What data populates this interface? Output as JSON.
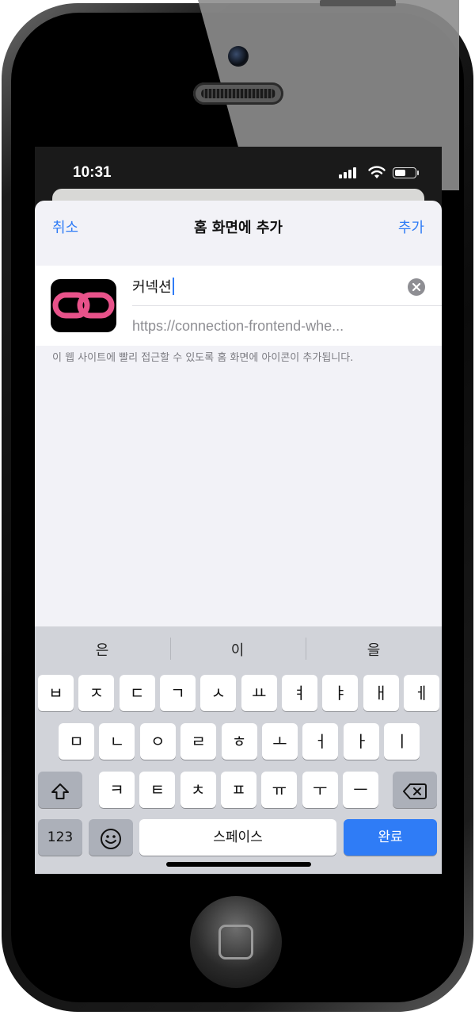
{
  "status": {
    "time": "10:31",
    "battery_level": 0.55
  },
  "sheet": {
    "cancel_label": "취소",
    "title": "홈 화면에 추가",
    "add_label": "추가",
    "name_value": "커넥션",
    "url": "https://connection-frontend-whe...",
    "description": "이 웹 사이트에 빨리 접근할 수 있도록 홈 화면에 아이콘이 추가됩니다."
  },
  "keyboard": {
    "suggestions": [
      "은",
      "이",
      "을"
    ],
    "row1": [
      "ㅂ",
      "ㅈ",
      "ㄷ",
      "ㄱ",
      "ㅅ",
      "ㅛ",
      "ㅕ",
      "ㅑ",
      "ㅐ",
      "ㅔ"
    ],
    "row2": [
      "ㅁ",
      "ㄴ",
      "ㅇ",
      "ㄹ",
      "ㅎ",
      "ㅗ",
      "ㅓ",
      "ㅏ",
      "ㅣ"
    ],
    "row3": [
      "ㅋ",
      "ㅌ",
      "ㅊ",
      "ㅍ",
      "ㅠ",
      "ㅜ",
      "ㅡ"
    ],
    "numbers_label": "123",
    "space_label": "스페이스",
    "done_label": "완료"
  },
  "icons": {
    "app_icon": "link-chain-icon",
    "shift": "shift-icon",
    "backspace": "backspace-icon",
    "emoji": "emoji-icon",
    "globe": "globe-icon",
    "mic": "microphone-icon",
    "clear": "clear-text-icon"
  },
  "colors": {
    "accent": "#2f7cf6",
    "brand_pink": "#e8528a",
    "keyboard_bg": "#d1d3d9"
  }
}
